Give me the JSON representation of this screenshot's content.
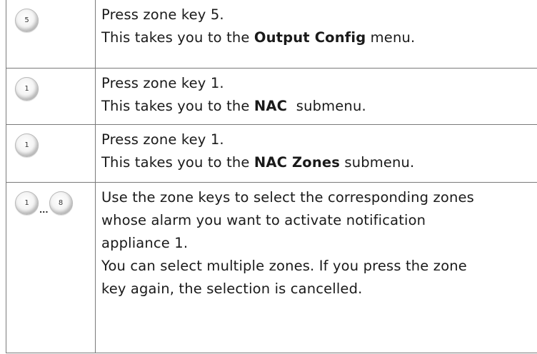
{
  "steps": [
    {
      "keys": [
        "5"
      ],
      "line1": "Press zone key 5.",
      "line2_pre": "This takes you to the ",
      "line2_bold": "Output Config",
      "line2_post": " menu."
    },
    {
      "keys": [
        "1"
      ],
      "line1": "Press zone key 1.",
      "line2_pre": "This takes you to the ",
      "line2_bold": "NAC",
      "line2_post": "  submenu."
    },
    {
      "keys": [
        "1"
      ],
      "line1": "Press zone key 1.",
      "line2_pre": "This takes you to the ",
      "line2_bold": "NAC Zones",
      "line2_post": " submenu."
    },
    {
      "keys": [
        "1",
        "8"
      ],
      "range_separator": "...",
      "para1_l1": "Use the zone keys to select the corresponding zones",
      "para1_l2": "whose alarm you want to activate notification",
      "para1_l3": "appliance 1.",
      "para2_l1": "You can select multiple zones. If you press the zone",
      "para2_l2": "key again, the selection is cancelled."
    }
  ]
}
